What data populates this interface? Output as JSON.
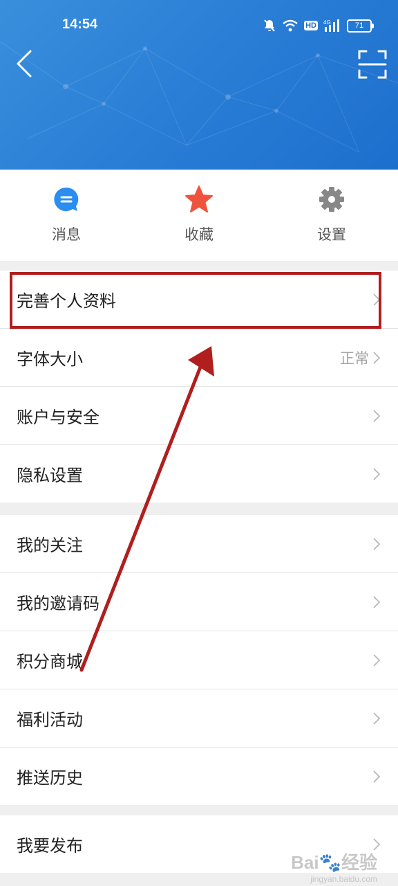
{
  "status_bar": {
    "time": "14:54",
    "hd": "HD",
    "signal": "4G",
    "battery": "71"
  },
  "header": {
    "back_icon": "chevron-left-icon",
    "scan_icon": "scan-icon"
  },
  "quick_actions": [
    {
      "label": "消息",
      "icon": "message-icon",
      "color": "#2a8ef0"
    },
    {
      "label": "收藏",
      "icon": "star-icon",
      "color": "#f0533d"
    },
    {
      "label": "设置",
      "icon": "gear-icon",
      "color": "#888888"
    }
  ],
  "menu_group_1": [
    {
      "label": "完善个人资料",
      "value": ""
    },
    {
      "label": "字体大小",
      "value": "正常"
    },
    {
      "label": "账户与安全",
      "value": ""
    },
    {
      "label": "隐私设置",
      "value": ""
    }
  ],
  "menu_group_2": [
    {
      "label": "我的关注",
      "value": ""
    },
    {
      "label": "我的邀请码",
      "value": ""
    },
    {
      "label": "积分商城",
      "value": ""
    },
    {
      "label": "福利活动",
      "value": ""
    },
    {
      "label": "推送历史",
      "value": ""
    }
  ],
  "menu_group_3": [
    {
      "label": "我要发布",
      "value": ""
    }
  ],
  "annotation": {
    "color": "#b01e1e"
  },
  "watermark": {
    "text": "Bai",
    "suffix": "经验",
    "url": "jingyan.baidu.com"
  }
}
